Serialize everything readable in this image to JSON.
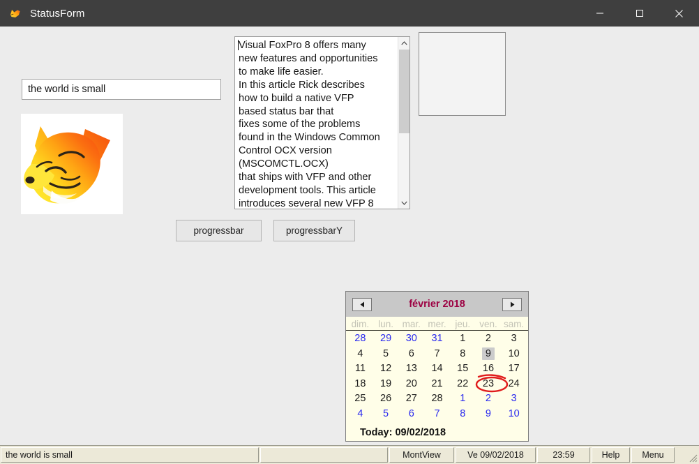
{
  "window": {
    "title": "StatusForm",
    "icon": "foxpro-fox-icon",
    "titlebar_color": "#3f3f3f",
    "background_color": "#ececec",
    "controls": [
      {
        "name": "minimize-button",
        "glyph": "minimize-icon"
      },
      {
        "name": "maximize-button",
        "glyph": "maximize-icon"
      },
      {
        "name": "close-button",
        "glyph": "close-icon"
      }
    ]
  },
  "form": {
    "textbox": {
      "value": "the world is small",
      "placeholder": ""
    },
    "image": {
      "name": "foxpro-fox-logo",
      "alt": "Visual FoxPro fox head logo"
    },
    "editbox": {
      "text": "Visual FoxPro 8 offers many\nnew features and opportunities\nto make life easier.\nIn this article Rick describes\nhow to build a native VFP\nbased status bar that\nfixes some of the problems\nfound in the Windows Common\nControl OCX version\n(MSCOMCTL.OCX)\nthat ships with VFP and other\ndevelopment tools. This article\nintroduces several new VFP 8",
      "scroll_up_glyph": "⌃",
      "scroll_down_glyph": "⌄"
    },
    "emptybox": {
      "label": ""
    },
    "buttons": {
      "progressbar": "progressbar",
      "progressbarY": "progressbarY"
    }
  },
  "calendar": {
    "title": "février 2018",
    "title_color": "#9c0042",
    "prev_glyph": "◄",
    "next_glyph": "►",
    "daynames": [
      "dim.",
      "lun.",
      "mar.",
      "mer.",
      "jeu.",
      "ven.",
      "sam."
    ],
    "weeks": [
      [
        {
          "n": "28",
          "other": true
        },
        {
          "n": "29",
          "other": true
        },
        {
          "n": "30",
          "other": true
        },
        {
          "n": "31",
          "other": true
        },
        {
          "n": "1",
          "other": false
        },
        {
          "n": "2",
          "other": false
        },
        {
          "n": "3",
          "other": false
        }
      ],
      [
        {
          "n": "4",
          "other": false
        },
        {
          "n": "5",
          "other": false
        },
        {
          "n": "6",
          "other": false
        },
        {
          "n": "7",
          "other": false
        },
        {
          "n": "8",
          "other": false
        },
        {
          "n": "9",
          "other": false,
          "today": true
        },
        {
          "n": "10",
          "other": false
        }
      ],
      [
        {
          "n": "11",
          "other": false
        },
        {
          "n": "12",
          "other": false
        },
        {
          "n": "13",
          "other": false
        },
        {
          "n": "14",
          "other": false
        },
        {
          "n": "15",
          "other": false
        },
        {
          "n": "16",
          "other": false
        },
        {
          "n": "17",
          "other": false
        }
      ],
      [
        {
          "n": "18",
          "other": false
        },
        {
          "n": "19",
          "other": false
        },
        {
          "n": "20",
          "other": false
        },
        {
          "n": "21",
          "other": false
        },
        {
          "n": "22",
          "other": false
        },
        {
          "n": "23",
          "other": false
        },
        {
          "n": "24",
          "other": false
        }
      ],
      [
        {
          "n": "25",
          "other": false
        },
        {
          "n": "26",
          "other": false
        },
        {
          "n": "27",
          "other": false
        },
        {
          "n": "28",
          "other": false
        },
        {
          "n": "1",
          "other": true
        },
        {
          "n": "2",
          "other": true
        },
        {
          "n": "3",
          "other": true
        }
      ],
      [
        {
          "n": "4",
          "other": true
        },
        {
          "n": "5",
          "other": true
        },
        {
          "n": "6",
          "other": true
        },
        {
          "n": "7",
          "other": true
        },
        {
          "n": "8",
          "other": true
        },
        {
          "n": "9",
          "other": true
        },
        {
          "n": "10",
          "other": true
        }
      ]
    ],
    "footer": "Today: 09/02/2018",
    "annotation_color": "#e01b1b"
  },
  "statusbar": {
    "message": "the world is small",
    "blank": "",
    "month_view": "MontView",
    "date": "Ve 09/02/2018",
    "time": "23:59",
    "help": "Help",
    "menu": "Menu"
  }
}
